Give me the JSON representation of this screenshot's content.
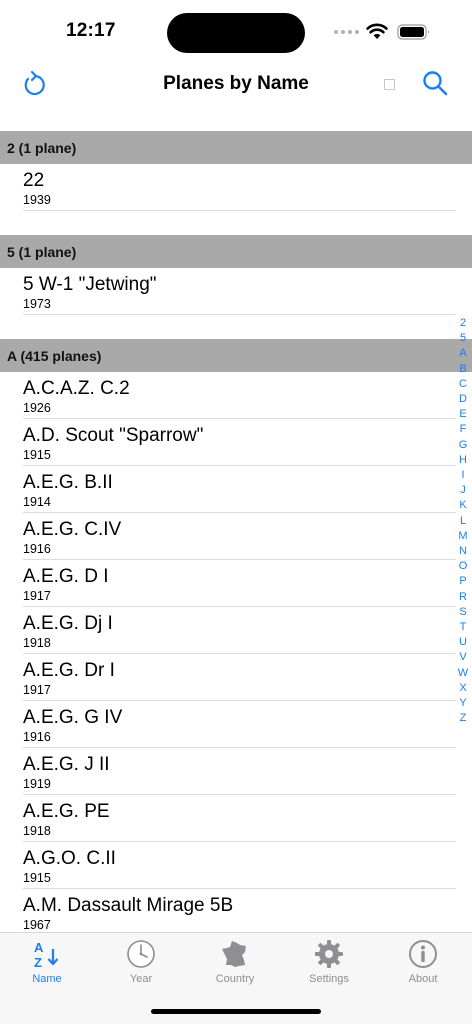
{
  "status_bar": {
    "time": "12:17"
  },
  "nav": {
    "title": "Planes by Name",
    "icons": [
      "refresh-icon",
      "search-icon"
    ]
  },
  "sections": [
    {
      "header": "2 (1 plane)",
      "rows": [
        {
          "name": "22",
          "year": "1939"
        }
      ]
    },
    {
      "header": "5 (1 plane)",
      "rows": [
        {
          "name": "5 W-1 \"Jetwing\"",
          "year": "1973"
        }
      ]
    },
    {
      "header": "A (415 planes)",
      "rows": [
        {
          "name": "A.C.A.Z. C.2",
          "year": "1926"
        },
        {
          "name": "A.D. Scout \"Sparrow\"",
          "year": "1915"
        },
        {
          "name": "A.E.G. B.II",
          "year": "1914"
        },
        {
          "name": "A.E.G. C.IV",
          "year": "1916"
        },
        {
          "name": "A.E.G. D I",
          "year": "1917"
        },
        {
          "name": "A.E.G. Dj I",
          "year": "1918"
        },
        {
          "name": "A.E.G. Dr I",
          "year": "1917"
        },
        {
          "name": "A.E.G. G IV",
          "year": "1916"
        },
        {
          "name": "A.E.G. J II",
          "year": "1919"
        },
        {
          "name": "A.E.G. PE",
          "year": "1918"
        },
        {
          "name": "A.G.O. C.II",
          "year": "1915"
        },
        {
          "name": "A.M. Dassault Mirage 5B",
          "year": "1967"
        }
      ]
    }
  ],
  "index": [
    "2",
    "5",
    "A",
    "B",
    "C",
    "D",
    "E",
    "F",
    "G",
    "H",
    "I",
    "J",
    "K",
    "L",
    "M",
    "N",
    "O",
    "P",
    "R",
    "S",
    "T",
    "U",
    "V",
    "W",
    "X",
    "Y",
    "Z"
  ],
  "tabs": [
    {
      "label": "Name",
      "icon": "az-sort-icon",
      "active": true
    },
    {
      "label": "Year",
      "icon": "clock-icon",
      "active": false
    },
    {
      "label": "Country",
      "icon": "france-map-icon",
      "active": false
    },
    {
      "label": "Settings",
      "icon": "gear-icon",
      "active": false
    },
    {
      "label": "About",
      "icon": "info-icon",
      "active": false
    }
  ],
  "colors": {
    "accent": "#1a7ff0",
    "section_header_bg": "#a9a9a9",
    "tab_inactive": "#8e8e93"
  }
}
